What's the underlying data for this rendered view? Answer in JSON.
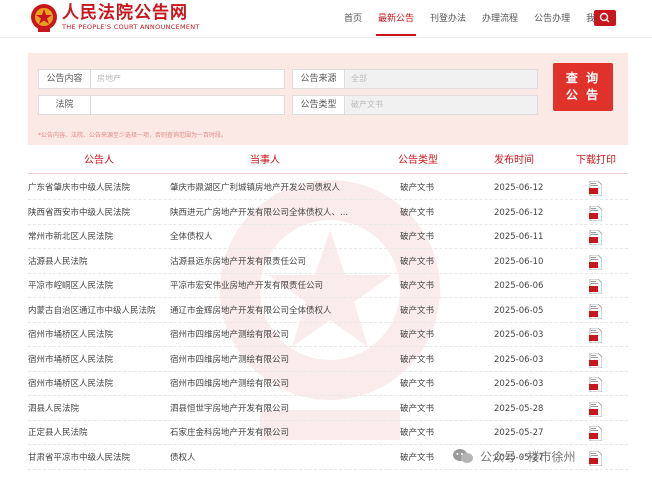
{
  "header": {
    "title": "人民法院公告网",
    "subtitle": "THE PEOPLE'S COURT ANNOUNCEMENT",
    "nav": [
      "首页",
      "最新公告",
      "刊登办法",
      "办理流程",
      "公告办理",
      "我的"
    ],
    "active_nav": "最新公告"
  },
  "search": {
    "fields": [
      {
        "label": "公告内容",
        "placeholder": "房地产"
      },
      {
        "label": "法院",
        "placeholder": ""
      },
      {
        "label": "公告来源",
        "placeholder": "全部"
      },
      {
        "label": "公告类型",
        "placeholder": "破产文书"
      }
    ],
    "button": "查 询\n公 告",
    "tip": "*公告内容、法院、公告来源至少选择一项，否则查询范围为一百时段。"
  },
  "table": {
    "headers": [
      "公告人",
      "当事人",
      "公告类型",
      "发布时间",
      "下载打印"
    ],
    "rows": [
      [
        "广东省肇庆市中级人民法院",
        "肇庆市鼎湖区广利城镇房地产开发公司债权人",
        "破产文书",
        "2025-06-12"
      ],
      [
        "陕西省西安市中级人民法院",
        "陕西进元广房地产开发有限公司全体债权人、...",
        "破产文书",
        "2025-06-12"
      ],
      [
        "常州市新北区人民法院",
        "全体债权人",
        "破产文书",
        "2025-06-11"
      ],
      [
        "沽源县人民法院",
        "沽源县远东房地产开发有限责任公司",
        "破产文书",
        "2025-06-10"
      ],
      [
        "平凉市崆峒区人民法院",
        "平凉市宏安伟业房地产开发有限责任公司",
        "破产文书",
        "2025-06-06"
      ],
      [
        "内蒙古自治区通辽市中级人民法院",
        "通辽市金辉房地产开发有限公司全体债权人",
        "破产文书",
        "2025-06-05"
      ],
      [
        "宿州市埇桥区人民法院",
        "宿州市四维房地产测绘有限公司",
        "破产文书",
        "2025-06-03"
      ],
      [
        "宿州市埇桥区人民法院",
        "宿州市四维房地产测绘有限公司",
        "破产文书",
        "2025-06-03"
      ],
      [
        "宿州市埇桥区人民法院",
        "宿州市四维房地产测绘有限公司",
        "破产文书",
        "2025-06-03"
      ],
      [
        "泗县人民法院",
        "泗县恒世宇房地产开发有限公司",
        "破产文书",
        "2025-05-28"
      ],
      [
        "正定县人民法院",
        "石家庄金科房地产开发有限公司",
        "破产文书",
        "2025-05-27"
      ],
      [
        "甘肃省平凉市中级人民法院",
        "债权人",
        "破产文书",
        "2025-05-27"
      ]
    ]
  },
  "footer": {
    "watermark": "公众号 · 楼市徐州"
  },
  "colors": {
    "brand": "#c8161d",
    "button": "#e0322b",
    "panel": "#fbe9e6"
  }
}
